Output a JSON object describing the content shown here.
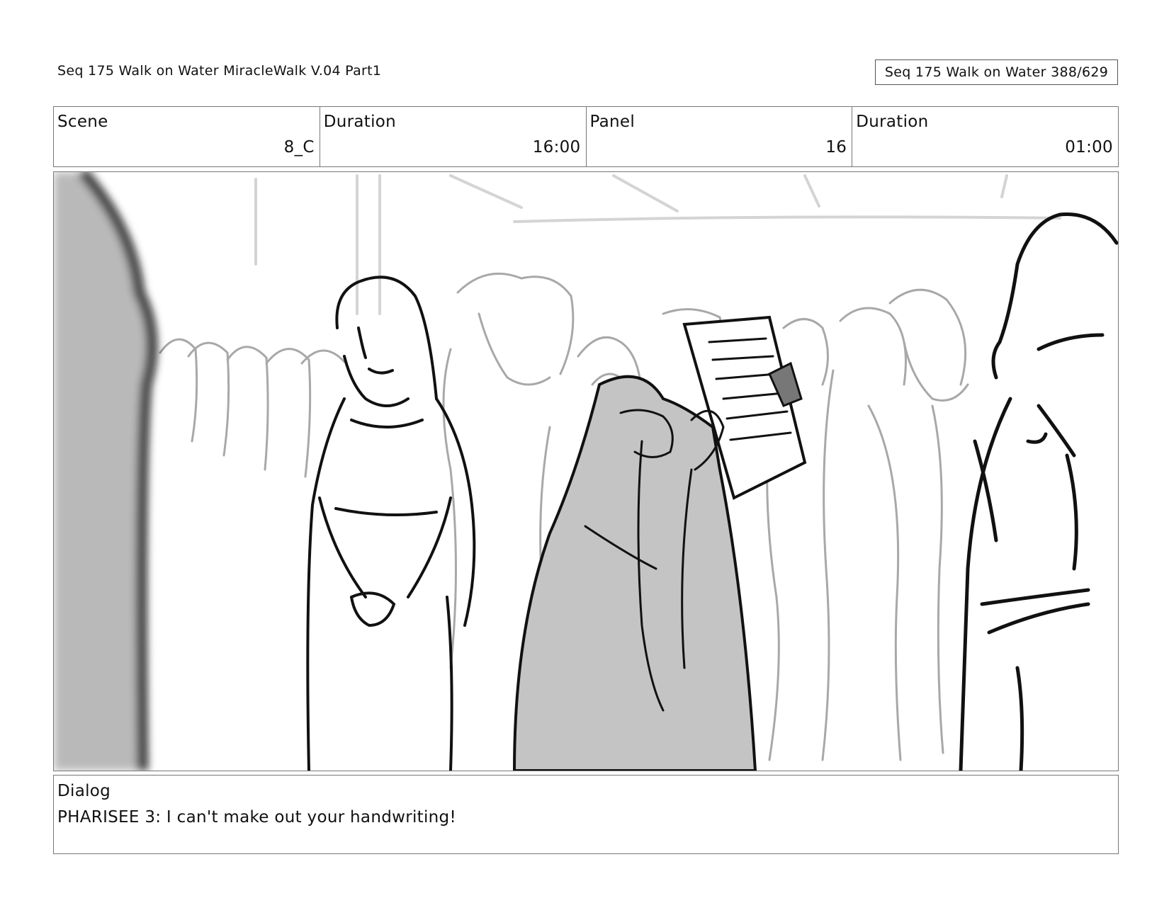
{
  "header": {
    "title": "Seq 175 Walk on Water  MiracleWalk V.04 Part1",
    "page_counter": "Seq 175 Walk on Water 388/629"
  },
  "info": {
    "scene_label": "Scene",
    "scene_value": "8_C",
    "scene_duration_label": "Duration",
    "scene_duration_value": "16:00",
    "panel_label": "Panel",
    "panel_value": "16",
    "panel_duration_label": "Duration",
    "panel_duration_value": "01:00"
  },
  "panel": {
    "image_description_icon": "storyboard-sketch-image"
  },
  "dialog": {
    "label": "Dialog",
    "text": "PHARISEE 3: I can't make out your handwriting!"
  }
}
